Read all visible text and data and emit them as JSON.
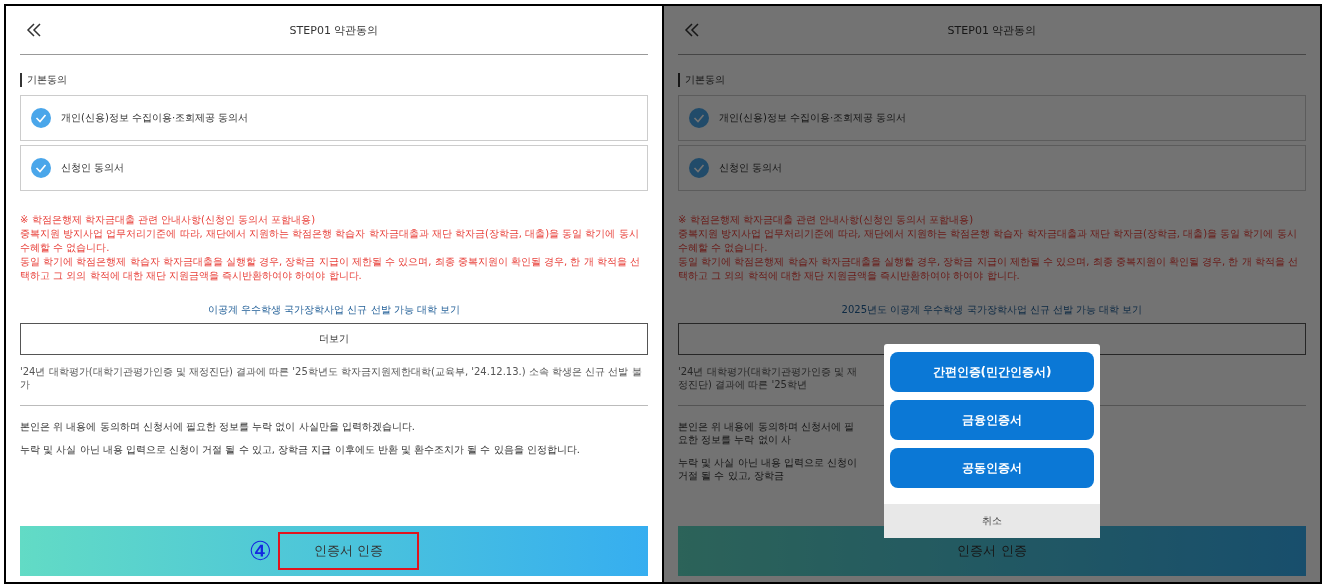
{
  "screens": [
    {
      "title": "STEP01 약관동의",
      "dimmed": false,
      "section": "기본동의",
      "consents": [
        {
          "label": "개인(신용)정보 수집이용·조회제공 동의서",
          "checked": true
        },
        {
          "label": "신청인 동의서",
          "checked": true
        }
      ],
      "notice": {
        "title": "※ 학점은행제 학자금대출 관련 안내사항(신청인 동의서 포함내용)",
        "lines": [
          "중복지원 방지사업 업무처리기준에 따라, 재단에서 지원하는 학점은행 학습자 학자금대출과 재단 학자금(장학금, 대출)을 동일 학기에 동시 수혜할 수 없습니다.",
          "동일 학기에 학점은행제 학습자 학자금대출을 실행할 경우, 장학금 지급이 제한될 수 있으며, 최종 중복지원이 확인될 경우, 한 개 학적을 선택하고 그 외의 학적에 대한 재단 지원금액을 즉시반환하여야 하여야 합니다."
        ]
      },
      "link": "이공계 우수학생 국가장학사업 신규 선발 가능 대학 보기",
      "more_button": "더보기",
      "footnote": "'24년 대학평가(대학기관평가인증 및 재정진단) 결과에 따른 '25학년도 학자금지원제한대학(교육부, '24.12.13.) 소속 학생은 신규 선발 불가",
      "agreements": [
        "본인은 위 내용에 동의하며 신청서에 필요한 정보를 누락 없이 사실만을 입력하겠습니다.",
        "누락 및 사실 아닌 내용 입력으로 신청이 거절 될 수 있고, 장학금 지급 이후에도 반환 및 환수조치가 될 수 있음을 인정합니다."
      ],
      "cert_button": {
        "label": "인증서 인증",
        "annotation": "④",
        "highlighted": true
      }
    },
    {
      "title": "STEP01 약관동의",
      "dimmed": true,
      "section": "기본동의",
      "consents": [
        {
          "label": "개인(신용)정보 수집이용·조회제공 동의서",
          "checked": true
        },
        {
          "label": "신청인 동의서",
          "checked": true
        }
      ],
      "notice": {
        "title": "※ 학점은행제 학자금대출 관련 안내사항(신청인 동의서 포함내용)",
        "lines": [
          "중복지원 방지사업 업무처리기준에 따라, 재단에서 지원하는 학점은행 학습자 학자금대출과 재단 학자금(장학금, 대출)을 동일 학기에 동시 수혜할 수 없습니다.",
          "동일 학기에 학점은행제 학습자 학자금대출을 실행할 경우, 장학금 지급이 제한될 수 있으며, 최종 중복지원이 확인될 경우, 한 개 학적을 선택하고 그 외의 학적에 대한 재단 지원금액을 즉시반환하여야 하여야 합니다."
        ]
      },
      "link": "2025년도 이공계 우수학생 국가장학사업 신규 선발 가능 대학 보기",
      "footnote": "'24년 대학평가(대학기관평가인증 및 재정진단) 결과에 따른 '25학년",
      "agreements": [
        "본인은 위 내용에 동의하며 신청서에 필요한 정보를 누락 없이 사",
        "누락 및 사실 아닌 내용 입력으로 신청이 거절 될 수 있고, 장학금"
      ],
      "cert_button": {
        "label": "인증서 인증",
        "highlighted": false
      },
      "modal": {
        "options": [
          "간편인증(민간인증서)",
          "금융인증서",
          "공동인증서"
        ],
        "cancel": "취소"
      }
    }
  ]
}
